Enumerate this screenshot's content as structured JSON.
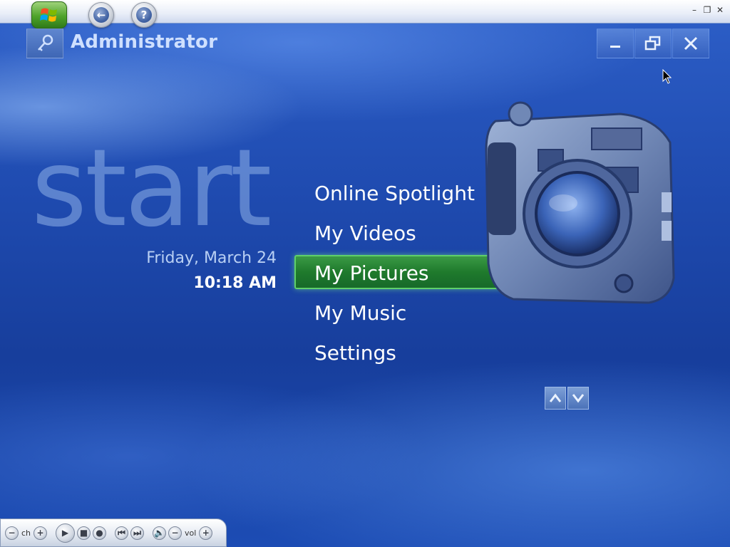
{
  "window": {
    "controls": {
      "minimize": "–",
      "restore": "❐",
      "close": "✕"
    }
  },
  "nav": {
    "back_symbol": "←",
    "help_symbol": "?"
  },
  "user": {
    "name": "Administrator"
  },
  "window_buttons": {
    "minimize": "▁",
    "restore": "⧉",
    "close": "✕"
  },
  "start": {
    "title": "start",
    "date": "Friday, March 24",
    "time": "10:18 AM"
  },
  "menu": {
    "items": [
      {
        "label": "Online Spotlight",
        "selected": false
      },
      {
        "label": "My Videos",
        "selected": false
      },
      {
        "label": "My Pictures",
        "selected": true
      },
      {
        "label": "My Music",
        "selected": false
      },
      {
        "label": "Settings",
        "selected": false
      }
    ]
  },
  "scroll": {
    "up": "▲",
    "down": "▼"
  },
  "transport": {
    "ch_minus": "−",
    "ch_label": "ch",
    "ch_plus": "+",
    "play": "▶",
    "stop": "■",
    "record": "●",
    "prev": "⏮",
    "next": "⏭",
    "mute": "🔈",
    "vol_minus": "−",
    "vol_label": "vol",
    "vol_plus": "+"
  },
  "colors": {
    "selected_bg": "#1f7a2c",
    "accent": "#5fd06a",
    "background": "#1f4bb0"
  }
}
